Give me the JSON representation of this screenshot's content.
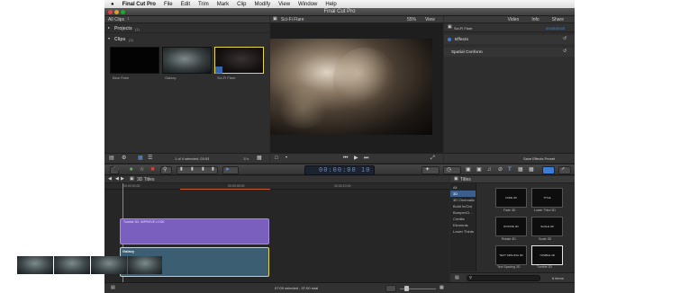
{
  "menubar": {
    "apple": "",
    "app_name": "Final Cut Pro",
    "items": [
      "File",
      "Edit",
      "Trim",
      "Mark",
      "Clip",
      "Modify",
      "View",
      "Window",
      "Help"
    ]
  },
  "window": {
    "title": "Final Cut Pro"
  },
  "browser": {
    "selector": "All Clips",
    "projects_label": "Projects",
    "projects_count": "(1)",
    "clips_label": "Clips",
    "clips_count": "(3)",
    "clips": [
      {
        "name": "Blue Flare"
      },
      {
        "name": "Galaxy"
      },
      {
        "name": "Sci-Fi Flare"
      }
    ],
    "status": "1 of 4 selected, 03:03",
    "duration_menu": "30s"
  },
  "viewer": {
    "clip_name": "Sci-Fi Flare",
    "zoom": "55%",
    "view_menu": "View"
  },
  "inspector": {
    "tabs": [
      "Video",
      "Info",
      "Share"
    ],
    "clip_name": "Sci-Fi Flare",
    "timecode": "00:00:03:03",
    "section_effects": "Effects",
    "section_spatial": "Spatial Conform",
    "save_preset": "Save Effects Preset"
  },
  "toolbar": {
    "timecode": "00:00:00 10"
  },
  "timeline": {
    "index_label": "3D Titles",
    "ruler": [
      "00:00:00:00",
      "00:00:05:00",
      "00:00:10:00"
    ],
    "title_clip": "Tumble 3D: IMPROVE LOOK",
    "video_clip": "Galaxy",
    "status": "07:00 selected - 07:00 total"
  },
  "titles_browser": {
    "header": "Titles",
    "categories": [
      "All",
      "3D",
      "3D Cinematic",
      "Build In/Out",
      "Bumper/O...",
      "Credits",
      "Elements",
      "Lower Thirds"
    ],
    "selected_category": "3D",
    "tiles": [
      {
        "name": "Fade 3D",
        "preview": "FADE 3D"
      },
      {
        "name": "Lower Third 3D",
        "preview": "TITLE"
      },
      {
        "name": "Rotate 3D",
        "preview": "ROTATE 3D"
      },
      {
        "name": "Scale 3D",
        "preview": "SCALE 3D"
      },
      {
        "name": "Text Spacing 3D",
        "preview": "TEXT SPACING 3D"
      },
      {
        "name": "Tumble 3D",
        "preview": "TUMBLE 3D"
      }
    ],
    "item_count": "6 items"
  },
  "colors": {
    "accent_blue": "#3d7dd8",
    "title_clip_purple": "#7b5fbf",
    "selection_yellow": "#e6d84a"
  }
}
